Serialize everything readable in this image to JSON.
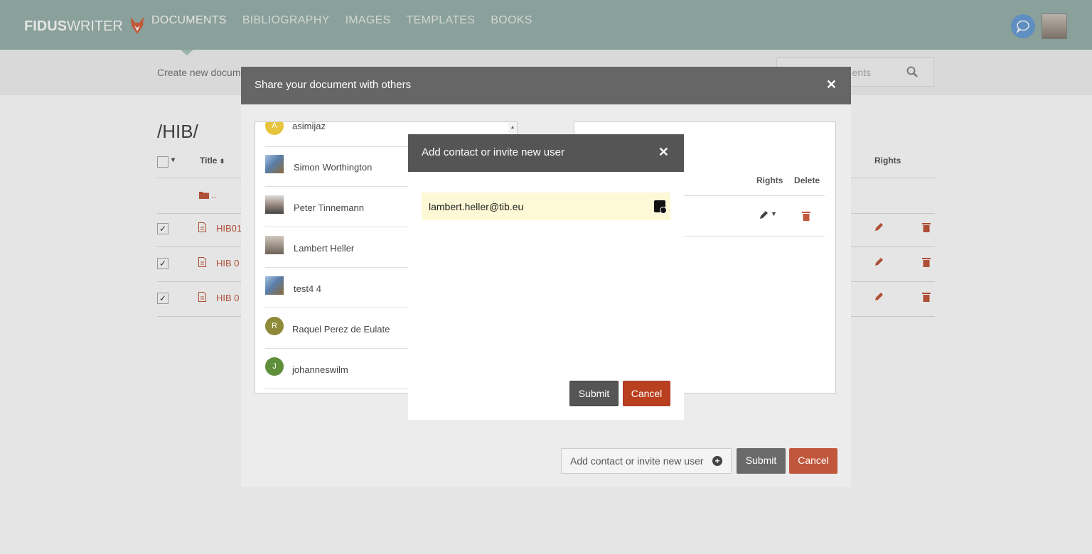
{
  "app": {
    "logo_bold": "FIDUS",
    "logo_light": "WRITER",
    "nav": [
      "DOCUMENTS",
      "BIBLIOGRAPHY",
      "IMAGES",
      "TEMPLATES",
      "BOOKS"
    ]
  },
  "toolbar": {
    "create_label": "Create new docum",
    "search_placeholder": "ents"
  },
  "folder": {
    "title": "/HIB/",
    "columns": {
      "title": "Title",
      "rights": "Rights"
    },
    "parent": "..",
    "rows": [
      {
        "title": "HIB01",
        "checked": true
      },
      {
        "title": "HIB 0",
        "checked": true
      },
      {
        "title": "HIB 0",
        "checked": true
      }
    ]
  },
  "share_dialog": {
    "title": "Share your document with others",
    "contacts": [
      {
        "name": "asimijaz",
        "initial": "A",
        "avatar_color": "#e6c53c"
      },
      {
        "name": "Simon Worthington",
        "initial": "",
        "avatar_color": "#5577aa"
      },
      {
        "name": "Peter Tinnemann",
        "initial": "",
        "avatar_color": "#8a7a70"
      },
      {
        "name": "Lambert Heller",
        "initial": "",
        "avatar_color": "#7a6a5e"
      },
      {
        "name": "test4 4",
        "initial": "",
        "avatar_color": "#5577aa"
      },
      {
        "name": "Raquel Perez de Eulate",
        "initial": "R",
        "avatar_color": "#8f8a3a"
      },
      {
        "name": "johanneswilm",
        "initial": "J",
        "avatar_color": "#5f8f3a"
      }
    ],
    "collab_headers": {
      "rights": "Rights",
      "delete": "Delete"
    },
    "add_contact_label": "Add contact or invite new user",
    "submit_label": "Submit",
    "cancel_label": "Cancel"
  },
  "add_dialog": {
    "title": "Add contact or invite new user",
    "email_value": "lambert.heller@tib.eu",
    "submit_label": "Submit",
    "cancel_label": "Cancel"
  },
  "colors": {
    "topbar": "#9ab3ac",
    "accent_red": "#c0573c",
    "dialog_header": "#666666"
  }
}
